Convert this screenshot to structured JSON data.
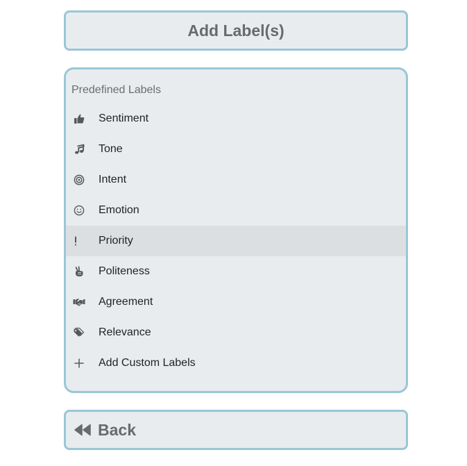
{
  "add_button": {
    "label": "Add Label(s)"
  },
  "panel": {
    "title": "Predefined Labels",
    "items": [
      {
        "label": "Sentiment",
        "icon": "thumbs-up-icon"
      },
      {
        "label": "Tone",
        "icon": "music-note-icon"
      },
      {
        "label": "Intent",
        "icon": "target-icon"
      },
      {
        "label": "Emotion",
        "icon": "smile-icon"
      },
      {
        "label": "Priority",
        "icon": "exclamation-icon",
        "highlighted": true
      },
      {
        "label": "Politeness",
        "icon": "peace-hand-icon"
      },
      {
        "label": "Agreement",
        "icon": "handshake-icon"
      },
      {
        "label": "Relevance",
        "icon": "tags-icon"
      },
      {
        "label": "Add Custom Labels",
        "icon": "plus-icon"
      }
    ]
  },
  "back_button": {
    "label": "Back",
    "icon": "backward-icon"
  },
  "colors": {
    "border": "#9ac6d8",
    "background": "#e8ecee",
    "highlight": "#dcdfe1",
    "muted_text": "#676b6e"
  }
}
